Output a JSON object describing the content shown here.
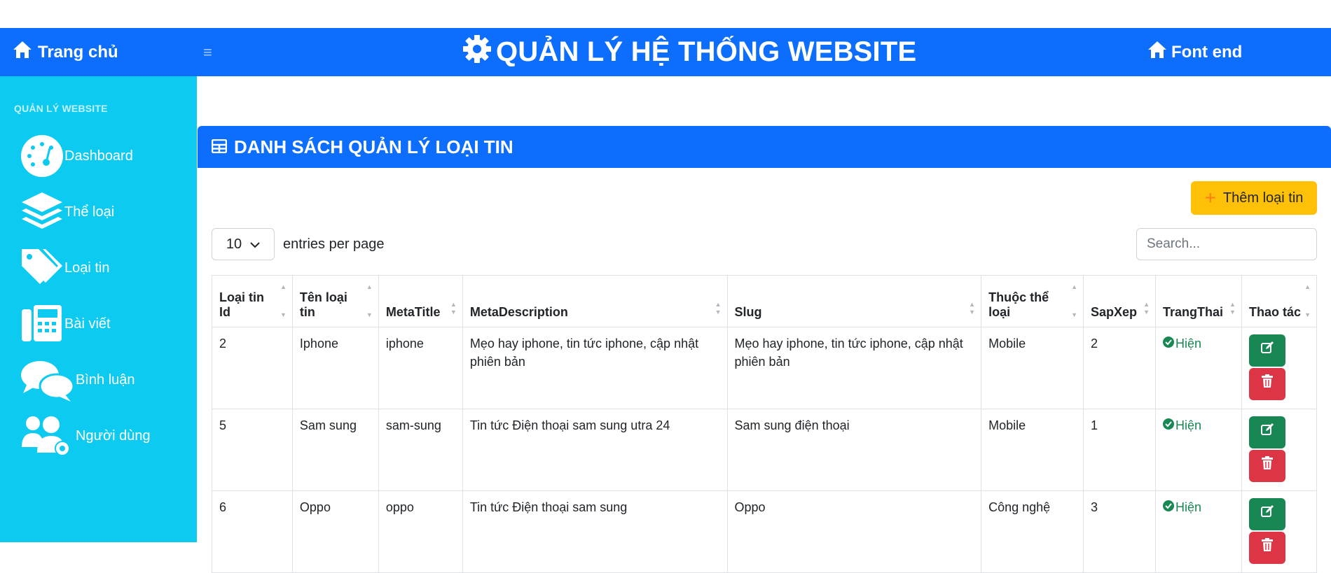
{
  "header": {
    "brand": "Trang chủ",
    "title": "QUẢN LÝ HỆ THỐNG WEBSITE",
    "frontend": "Font end",
    "bg_color": "#0d6efd"
  },
  "sidebar": {
    "heading": "QUẢN LÝ WEBSITE",
    "bg_color": "#0dcaf0",
    "items": [
      {
        "label": "Dashboard",
        "icon": "dashboard-gauge-icon"
      },
      {
        "label": "Thể loại",
        "icon": "layers-icon"
      },
      {
        "label": "Loại tin",
        "icon": "tags-icon"
      },
      {
        "label": "Bài viết",
        "icon": "fax-icon"
      },
      {
        "label": "Bình luận",
        "icon": "comments-icon"
      },
      {
        "label": "Người dùng",
        "icon": "users-gear-icon"
      }
    ]
  },
  "card": {
    "title": "DANH SÁCH QUẢN LÝ LOẠI TIN",
    "add_button": "Thêm loại tin",
    "entries_value": "10",
    "entries_label": "entries per page",
    "search_placeholder": "Search..."
  },
  "table": {
    "columns": [
      "Loại tin Id",
      "Tên loại tin",
      "MetaTitle",
      "MetaDescription",
      "Slug",
      "Thuộc thể loại",
      "SapXep",
      "TrangThai",
      "Thao tác"
    ],
    "rows": [
      {
        "id": "2",
        "name": "Iphone",
        "meta_title": "iphone",
        "meta_description": "Mẹo hay iphone, tin tức iphone, cập nhật phiên bản",
        "slug": "Mẹo hay iphone, tin tức iphone, cập nhật phiên bản",
        "category": "Mobile",
        "order": "2",
        "status": "Hiện"
      },
      {
        "id": "5",
        "name": "Sam sung",
        "meta_title": "sam-sung",
        "meta_description": "Tin tức Điện thoại sam sung utra 24",
        "slug": "Sam sung điện thoại",
        "category": "Mobile",
        "order": "1",
        "status": "Hiện"
      },
      {
        "id": "6",
        "name": "Oppo",
        "meta_title": "oppo",
        "meta_description": "Tin tức Điện thoại sam sung",
        "slug": "Oppo",
        "category": "Công nghệ",
        "order": "3",
        "status": "Hiện"
      }
    ]
  }
}
